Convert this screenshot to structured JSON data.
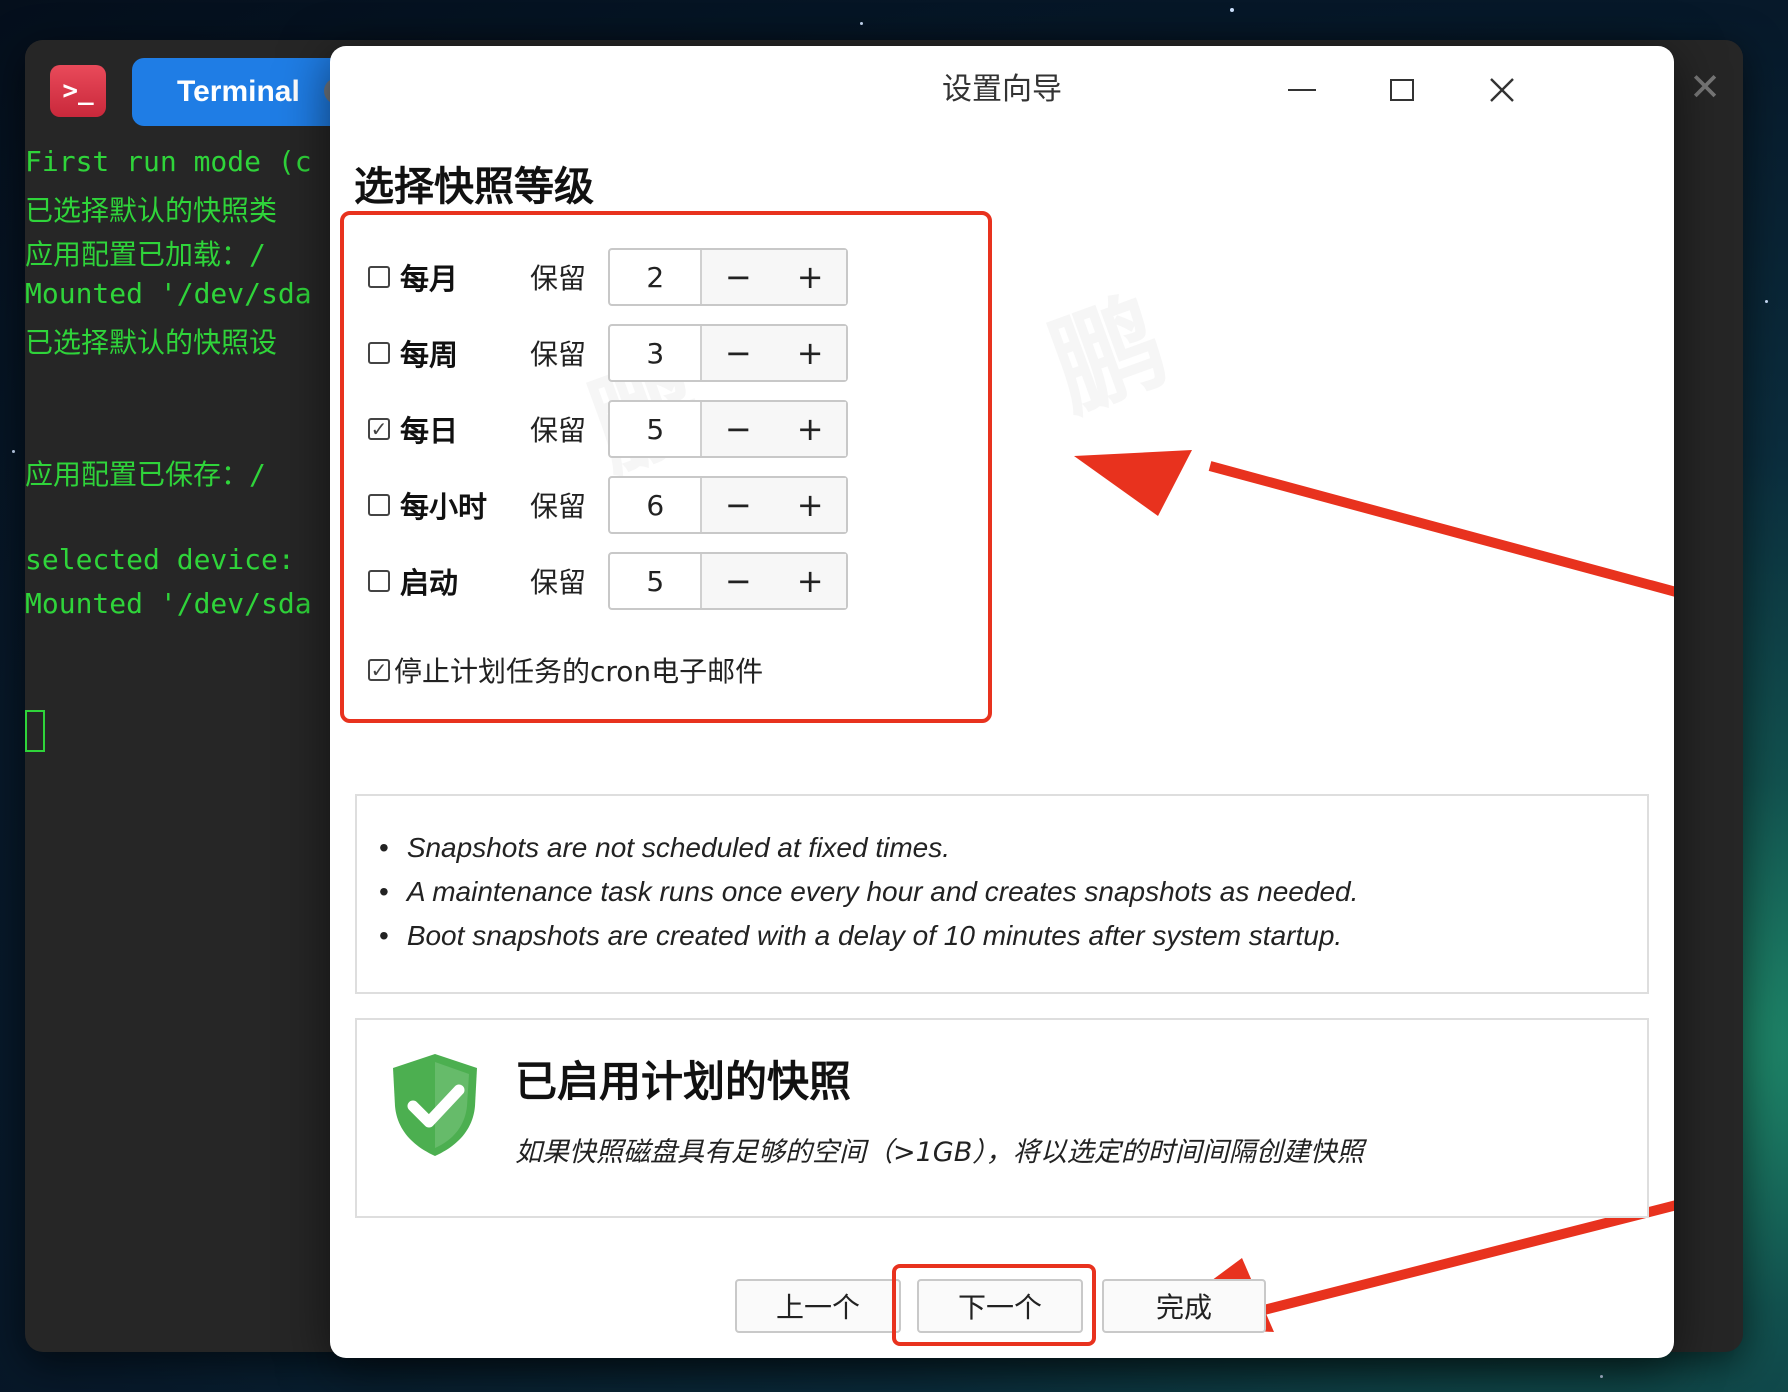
{
  "terminal": {
    "tab_label": "Terminal",
    "tab_close_glyph": "×",
    "window_close_glyph": "✕",
    "app_icon_glyph": ">_",
    "lines": [
      "First run mode (c",
      "已选择默认的快照类",
      "应用配置已加载：/",
      "Mounted '/dev/sda",
      "已选择默认的快照设",
      "",
      "应用配置已保存：/",
      "",
      "selected device:",
      "Mounted '/dev/sda"
    ]
  },
  "dialog": {
    "title": "设置向导",
    "heading": "选择快照等级",
    "keep_label": "保留",
    "minus_glyph": "−",
    "plus_glyph": "+",
    "check_glyph": "✓",
    "levels": [
      {
        "label": "每月",
        "checked": false,
        "value": "2"
      },
      {
        "label": "每周",
        "checked": false,
        "value": "3"
      },
      {
        "label": "每日",
        "checked": true,
        "value": "5"
      },
      {
        "label": "每小时",
        "checked": false,
        "value": "6"
      },
      {
        "label": "启动",
        "checked": false,
        "value": "5"
      }
    ],
    "cron": {
      "label": "停止计划任务的cron电子邮件",
      "checked": true
    },
    "info_bullets": [
      "Snapshots are not scheduled at fixed times.",
      "A maintenance task runs once every hour and creates snapshots as needed.",
      "Boot snapshots are created with a delay of 10 minutes after system startup."
    ],
    "bullet_glyph": "•",
    "status": {
      "title": "已启用计划的快照",
      "description": "如果快照磁盘具有足够的空间（>1GB），将以选定的时间间隔创建快照",
      "icon": "shield-check-icon"
    },
    "buttons": {
      "prev": "上一个",
      "next": "下一个",
      "finish": "完成"
    }
  },
  "colors": {
    "annotation_red": "#e8321e",
    "terminal_green": "#2fd43a",
    "tab_blue": "#1f7de5",
    "shield_green": "#4caf50"
  }
}
